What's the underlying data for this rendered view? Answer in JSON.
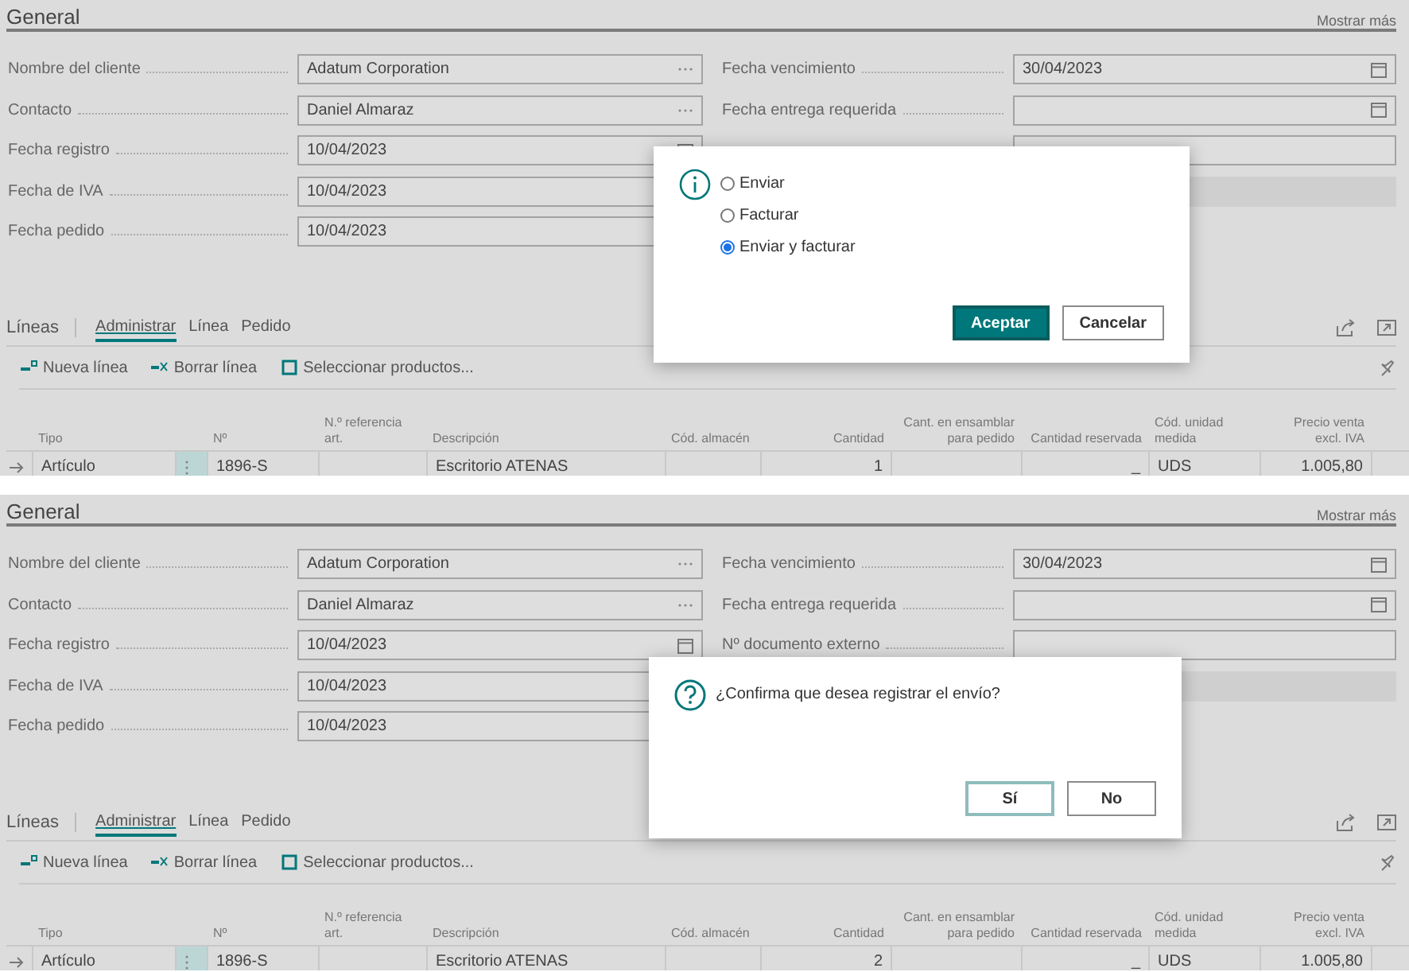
{
  "panels": [
    {
      "section_title": "General",
      "show_more": "Mostrar más",
      "left_fields": [
        {
          "label": "Nombre del cliente",
          "value": "Adatum Corporation",
          "kind": "lookup"
        },
        {
          "label": "Contacto",
          "value": "Daniel Almaraz",
          "kind": "lookup"
        },
        {
          "label": "Fecha registro",
          "value": "10/04/2023",
          "kind": "date"
        },
        {
          "label": "Fecha de IVA",
          "value": "10/04/2023",
          "kind": "text"
        },
        {
          "label": "Fecha pedido",
          "value": "10/04/2023",
          "kind": "text"
        }
      ],
      "right_fields": [
        {
          "label": "Fecha vencimiento",
          "value": "30/04/2023",
          "kind": "date"
        },
        {
          "label": "Fecha entrega requerida",
          "kind": "date"
        },
        {
          "kind": "text"
        },
        {
          "kind": "readonly"
        }
      ],
      "lines_title": "Líneas",
      "tabs": [
        {
          "label": "Administrar",
          "selected": true
        },
        {
          "label": "Línea",
          "selected": false
        },
        {
          "label": "Pedido",
          "selected": false
        }
      ],
      "actions": [
        "Nueva línea",
        "Borrar línea",
        "Seleccionar productos..."
      ],
      "columns": [
        "Tipo",
        "Nº",
        "N.º referencia art.",
        "Descripción",
        "Cód. almacén",
        "Cantidad",
        "Cant. en ensamblar para pedido",
        "Cantidad reservada",
        "Cód. unidad medida",
        "Precio venta excl. IVA"
      ],
      "row": {
        "tipo": "Artículo",
        "numero": "1896-S",
        "descripcion": "Escritorio ATENAS",
        "cantidad": "1",
        "cantidad_reservada": "_",
        "unidad": "UDS",
        "precio": "1.005,80"
      },
      "dialog": {
        "kind": "options",
        "options": [
          {
            "label": "Enviar",
            "selected": false
          },
          {
            "label": "Facturar",
            "selected": false
          },
          {
            "label": "Enviar y facturar",
            "selected": true
          }
        ],
        "buttons": [
          {
            "label": "Aceptar",
            "kind": "primary"
          },
          {
            "label": "Cancelar",
            "kind": "plain"
          }
        ]
      }
    },
    {
      "section_title": "General",
      "show_more": "Mostrar más",
      "left_fields": [
        {
          "label": "Nombre del cliente",
          "value": "Adatum Corporation",
          "kind": "lookup"
        },
        {
          "label": "Contacto",
          "value": "Daniel Almaraz",
          "kind": "lookup"
        },
        {
          "label": "Fecha registro",
          "value": "10/04/2023",
          "kind": "date"
        },
        {
          "label": "Fecha de IVA",
          "value": "10/04/2023",
          "kind": "text"
        },
        {
          "label": "Fecha pedido",
          "value": "10/04/2023",
          "kind": "text"
        }
      ],
      "right_fields": [
        {
          "label": "Fecha vencimiento",
          "value": "30/04/2023",
          "kind": "date"
        },
        {
          "label": "Fecha entrega requerida",
          "kind": "date"
        },
        {
          "label": "Nº documento externo",
          "kind": "text"
        },
        {
          "kind": "readonly"
        }
      ],
      "lines_title": "Líneas",
      "tabs": [
        {
          "label": "Administrar",
          "selected": true
        },
        {
          "label": "Línea",
          "selected": false
        },
        {
          "label": "Pedido",
          "selected": false
        }
      ],
      "actions": [
        "Nueva línea",
        "Borrar línea",
        "Seleccionar productos..."
      ],
      "columns": [
        "Tipo",
        "Nº",
        "N.º referencia art.",
        "Descripción",
        "Cód. almacén",
        "Cantidad",
        "Cant. en ensamblar para pedido",
        "Cantidad reservada",
        "Cód. unidad medida",
        "Precio venta excl. IVA"
      ],
      "row": {
        "tipo": "Artículo",
        "numero": "1896-S",
        "descripcion": "Escritorio ATENAS",
        "cantidad": "2",
        "cantidad_reservada": "_",
        "unidad": "UDS",
        "precio": "1.005,80"
      },
      "dialog": {
        "kind": "confirm",
        "message": "¿Confirma que desea registrar el envío?",
        "buttons": [
          {
            "label": "Sí",
            "kind": "focused"
          },
          {
            "label": "No",
            "kind": "plain"
          }
        ]
      }
    }
  ]
}
